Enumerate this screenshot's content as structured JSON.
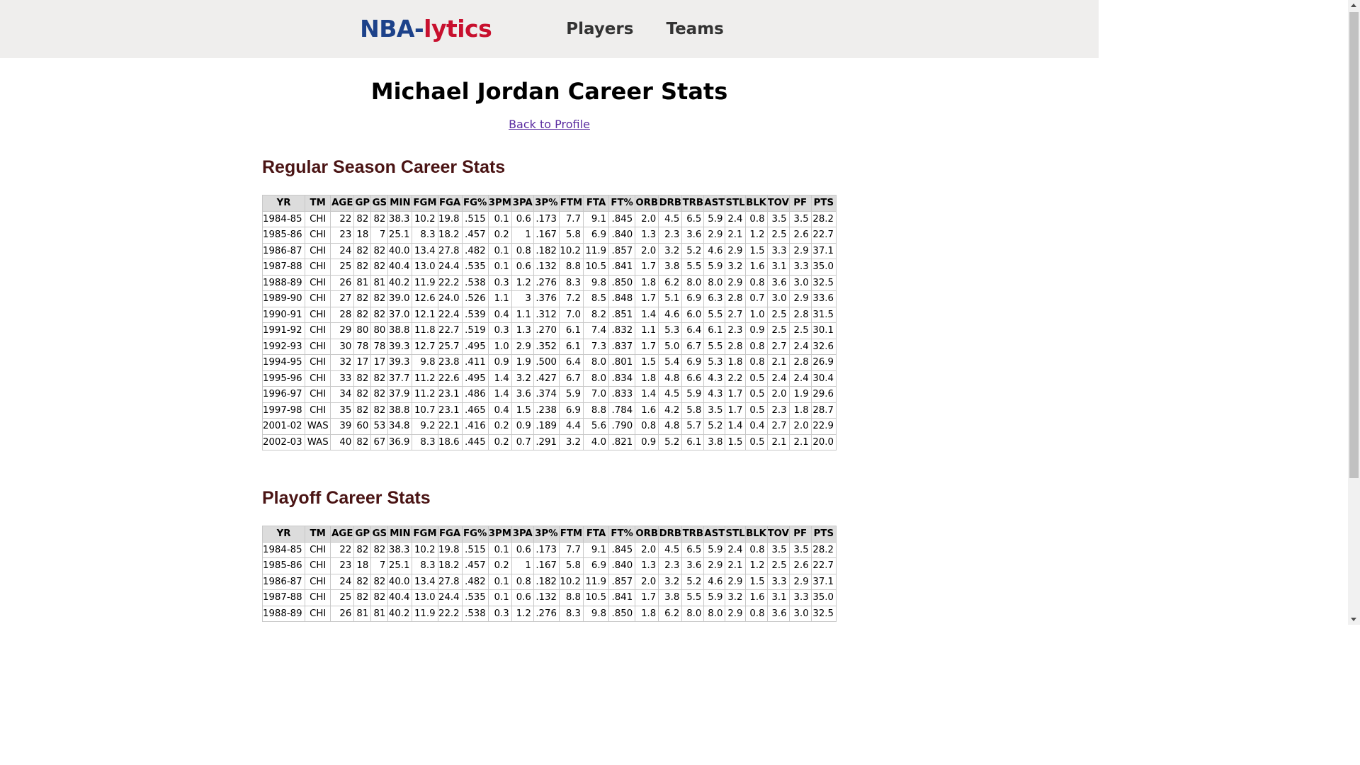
{
  "nav": {
    "brand_nba": "NBA",
    "brand_dash": "-",
    "brand_lytics": "lytics",
    "links": [
      "Players",
      "Teams"
    ]
  },
  "page": {
    "title": "Michael Jordan Career Stats",
    "back_link": "Back to Profile"
  },
  "columns": [
    "YR",
    "TM",
    "AGE",
    "GP",
    "GS",
    "MIN",
    "FGM",
    "FGA",
    "FG%",
    "3PM",
    "3PA",
    "3P%",
    "FTM",
    "FTA",
    "FT%",
    "ORB",
    "DRB",
    "TRB",
    "AST",
    "STL",
    "BLK",
    "TOV",
    "PF",
    "PTS"
  ],
  "regular": {
    "heading": "Regular Season Career Stats",
    "rows": [
      [
        "1984-85",
        "CHI",
        "22",
        "82",
        "82",
        "38.3",
        "10.2",
        "19.8",
        ".515",
        "0.1",
        "0.6",
        ".173",
        "7.7",
        "9.1",
        ".845",
        "2.0",
        "4.5",
        "6.5",
        "5.9",
        "2.4",
        "0.8",
        "3.5",
        "3.5",
        "28.2"
      ],
      [
        "1985-86",
        "CHI",
        "23",
        "18",
        "7",
        "25.1",
        "8.3",
        "18.2",
        ".457",
        "0.2",
        "1",
        ".167",
        "5.8",
        "6.9",
        ".840",
        "1.3",
        "2.3",
        "3.6",
        "2.9",
        "2.1",
        "1.2",
        "2.5",
        "2.6",
        "22.7"
      ],
      [
        "1986-87",
        "CHI",
        "24",
        "82",
        "82",
        "40.0",
        "13.4",
        "27.8",
        ".482",
        "0.1",
        "0.8",
        ".182",
        "10.2",
        "11.9",
        ".857",
        "2.0",
        "3.2",
        "5.2",
        "4.6",
        "2.9",
        "1.5",
        "3.3",
        "2.9",
        "37.1"
      ],
      [
        "1987-88",
        "CHI",
        "25",
        "82",
        "82",
        "40.4",
        "13.0",
        "24.4",
        ".535",
        "0.1",
        "0.6",
        ".132",
        "8.8",
        "10.5",
        ".841",
        "1.7",
        "3.8",
        "5.5",
        "5.9",
        "3.2",
        "1.6",
        "3.1",
        "3.3",
        "35.0"
      ],
      [
        "1988-89",
        "CHI",
        "26",
        "81",
        "81",
        "40.2",
        "11.9",
        "22.2",
        ".538",
        "0.3",
        "1.2",
        ".276",
        "8.3",
        "9.8",
        ".850",
        "1.8",
        "6.2",
        "8.0",
        "8.0",
        "2.9",
        "0.8",
        "3.6",
        "3.0",
        "32.5"
      ],
      [
        "1989-90",
        "CHI",
        "27",
        "82",
        "82",
        "39.0",
        "12.6",
        "24.0",
        ".526",
        "1.1",
        "3",
        ".376",
        "7.2",
        "8.5",
        ".848",
        "1.7",
        "5.1",
        "6.9",
        "6.3",
        "2.8",
        "0.7",
        "3.0",
        "2.9",
        "33.6"
      ],
      [
        "1990-91",
        "CHI",
        "28",
        "82",
        "82",
        "37.0",
        "12.1",
        "22.4",
        ".539",
        "0.4",
        "1.1",
        ".312",
        "7.0",
        "8.2",
        ".851",
        "1.4",
        "4.6",
        "6.0",
        "5.5",
        "2.7",
        "1.0",
        "2.5",
        "2.8",
        "31.5"
      ],
      [
        "1991-92",
        "CHI",
        "29",
        "80",
        "80",
        "38.8",
        "11.8",
        "22.7",
        ".519",
        "0.3",
        "1.3",
        ".270",
        "6.1",
        "7.4",
        ".832",
        "1.1",
        "5.3",
        "6.4",
        "6.1",
        "2.3",
        "0.9",
        "2.5",
        "2.5",
        "30.1"
      ],
      [
        "1992-93",
        "CHI",
        "30",
        "78",
        "78",
        "39.3",
        "12.7",
        "25.7",
        ".495",
        "1.0",
        "2.9",
        ".352",
        "6.1",
        "7.3",
        ".837",
        "1.7",
        "5.0",
        "6.7",
        "5.5",
        "2.8",
        "0.8",
        "2.7",
        "2.4",
        "32.6"
      ],
      [
        "1994-95",
        "CHI",
        "32",
        "17",
        "17",
        "39.3",
        "9.8",
        "23.8",
        ".411",
        "0.9",
        "1.9",
        ".500",
        "6.4",
        "8.0",
        ".801",
        "1.5",
        "5.4",
        "6.9",
        "5.3",
        "1.8",
        "0.8",
        "2.1",
        "2.8",
        "26.9"
      ],
      [
        "1995-96",
        "CHI",
        "33",
        "82",
        "82",
        "37.7",
        "11.2",
        "22.6",
        ".495",
        "1.4",
        "3.2",
        ".427",
        "6.7",
        "8.0",
        ".834",
        "1.8",
        "4.8",
        "6.6",
        "4.3",
        "2.2",
        "0.5",
        "2.4",
        "2.4",
        "30.4"
      ],
      [
        "1996-97",
        "CHI",
        "34",
        "82",
        "82",
        "37.9",
        "11.2",
        "23.1",
        ".486",
        "1.4",
        "3.6",
        ".374",
        "5.9",
        "7.0",
        ".833",
        "1.4",
        "4.5",
        "5.9",
        "4.3",
        "1.7",
        "0.5",
        "2.0",
        "1.9",
        "29.6"
      ],
      [
        "1997-98",
        "CHI",
        "35",
        "82",
        "82",
        "38.8",
        "10.7",
        "23.1",
        ".465",
        "0.4",
        "1.5",
        ".238",
        "6.9",
        "8.8",
        ".784",
        "1.6",
        "4.2",
        "5.8",
        "3.5",
        "1.7",
        "0.5",
        "2.3",
        "1.8",
        "28.7"
      ],
      [
        "2001-02",
        "WAS",
        "39",
        "60",
        "53",
        "34.8",
        "9.2",
        "22.1",
        ".416",
        "0.2",
        "0.9",
        ".189",
        "4.4",
        "5.6",
        ".790",
        "0.8",
        "4.8",
        "5.7",
        "5.2",
        "1.4",
        "0.4",
        "2.7",
        "2.0",
        "22.9"
      ],
      [
        "2002-03",
        "WAS",
        "40",
        "82",
        "67",
        "36.9",
        "8.3",
        "18.6",
        ".445",
        "0.2",
        "0.7",
        ".291",
        "3.2",
        "4.0",
        ".821",
        "0.9",
        "5.2",
        "6.1",
        "3.8",
        "1.5",
        "0.5",
        "2.1",
        "2.1",
        "20.0"
      ]
    ]
  },
  "playoff": {
    "heading": "Playoff Career Stats",
    "rows": [
      [
        "1984-85",
        "CHI",
        "22",
        "82",
        "82",
        "38.3",
        "10.2",
        "19.8",
        ".515",
        "0.1",
        "0.6",
        ".173",
        "7.7",
        "9.1",
        ".845",
        "2.0",
        "4.5",
        "6.5",
        "5.9",
        "2.4",
        "0.8",
        "3.5",
        "3.5",
        "28.2"
      ],
      [
        "1985-86",
        "CHI",
        "23",
        "18",
        "7",
        "25.1",
        "8.3",
        "18.2",
        ".457",
        "0.2",
        "1",
        ".167",
        "5.8",
        "6.9",
        ".840",
        "1.3",
        "2.3",
        "3.6",
        "2.9",
        "2.1",
        "1.2",
        "2.5",
        "2.6",
        "22.7"
      ],
      [
        "1986-87",
        "CHI",
        "24",
        "82",
        "82",
        "40.0",
        "13.4",
        "27.8",
        ".482",
        "0.1",
        "0.8",
        ".182",
        "10.2",
        "11.9",
        ".857",
        "2.0",
        "3.2",
        "5.2",
        "4.6",
        "2.9",
        "1.5",
        "3.3",
        "2.9",
        "37.1"
      ],
      [
        "1987-88",
        "CHI",
        "25",
        "82",
        "82",
        "40.4",
        "13.0",
        "24.4",
        ".535",
        "0.1",
        "0.6",
        ".132",
        "8.8",
        "10.5",
        ".841",
        "1.7",
        "3.8",
        "5.5",
        "5.9",
        "3.2",
        "1.6",
        "3.1",
        "3.3",
        "35.0"
      ],
      [
        "1988-89",
        "CHI",
        "26",
        "81",
        "81",
        "40.2",
        "11.9",
        "22.2",
        ".538",
        "0.3",
        "1.2",
        ".276",
        "8.3",
        "9.8",
        ".850",
        "1.8",
        "6.2",
        "8.0",
        "8.0",
        "2.9",
        "0.8",
        "3.6",
        "3.0",
        "32.5"
      ]
    ]
  }
}
